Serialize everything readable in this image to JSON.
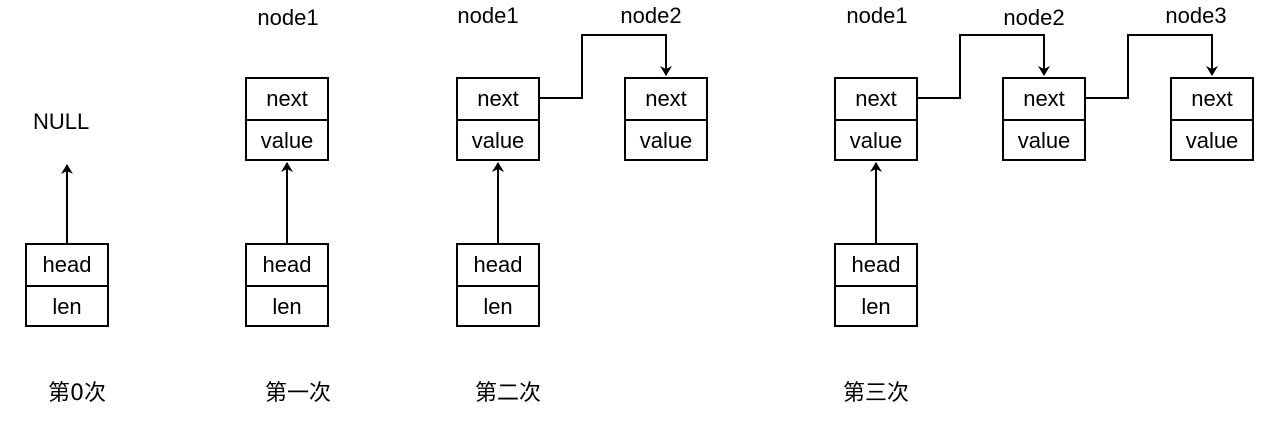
{
  "null_label": "NULL",
  "head_cell": "head",
  "len_cell": "len",
  "next_cell": "next",
  "value_cell": "value",
  "node_labels": [
    "node1",
    "node2",
    "node3"
  ],
  "steps": [
    "第0次",
    "第一次",
    "第二次",
    "第三次"
  ]
}
